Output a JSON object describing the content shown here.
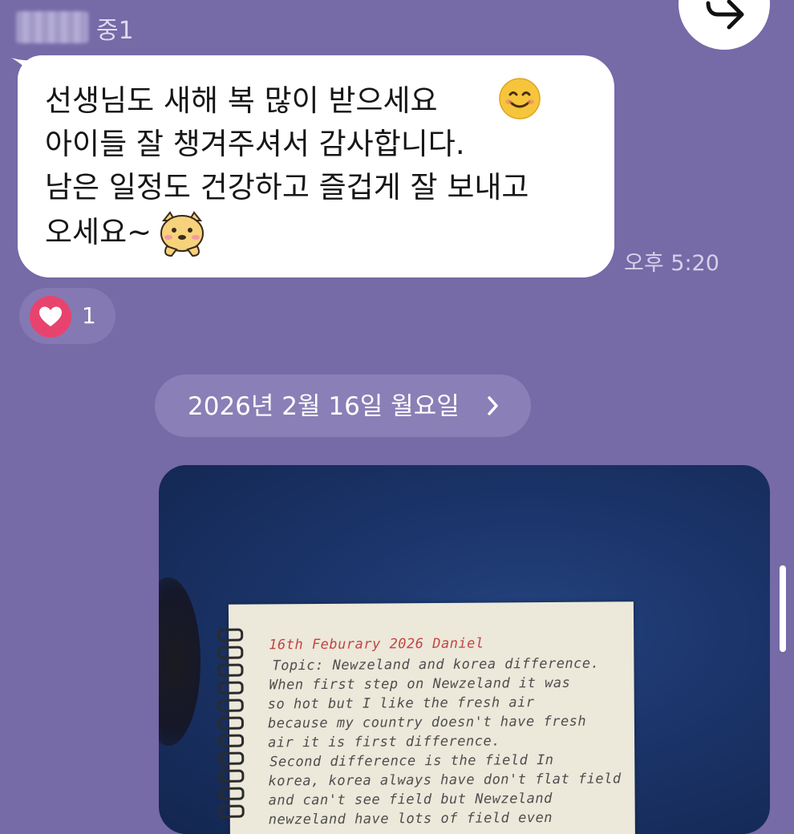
{
  "sender": {
    "name_suffix": "중1"
  },
  "message": {
    "lines": [
      "선생님도 새해 복 많이 받으세요",
      "아이들 잘 챙겨주셔서 감사합니다.",
      "남은 일정도 건강하고 즐겁게 잘 보내고",
      "오세요~"
    ],
    "time": "오후 5:20",
    "emojis": [
      "smiling-face-emoji",
      "cat-sticker-emoji"
    ]
  },
  "reaction": {
    "icon": "heart-icon",
    "count": "1",
    "color": "#e8436f"
  },
  "date_divider": {
    "label": "2026년 2월 16일 월요일",
    "chevron": "›"
  },
  "photo": {
    "notebook_lines": [
      "16th  Feburary 2026        Daniel",
      "Topic: Newzeland and korea difference.",
      "When first step on Newzeland it was",
      "so hot but I like the fresh air",
      "because my country doesn't have fresh",
      "air  it is first difference.",
      " Second difference is the field  In",
      "korea, korea always have don't flat field",
      "and can't see field but Newzeland",
      "newzeland have lots of field even"
    ]
  },
  "colors": {
    "background": "#766aa7",
    "bubble": "#ffffff",
    "accent_heart": "#e8436f"
  }
}
